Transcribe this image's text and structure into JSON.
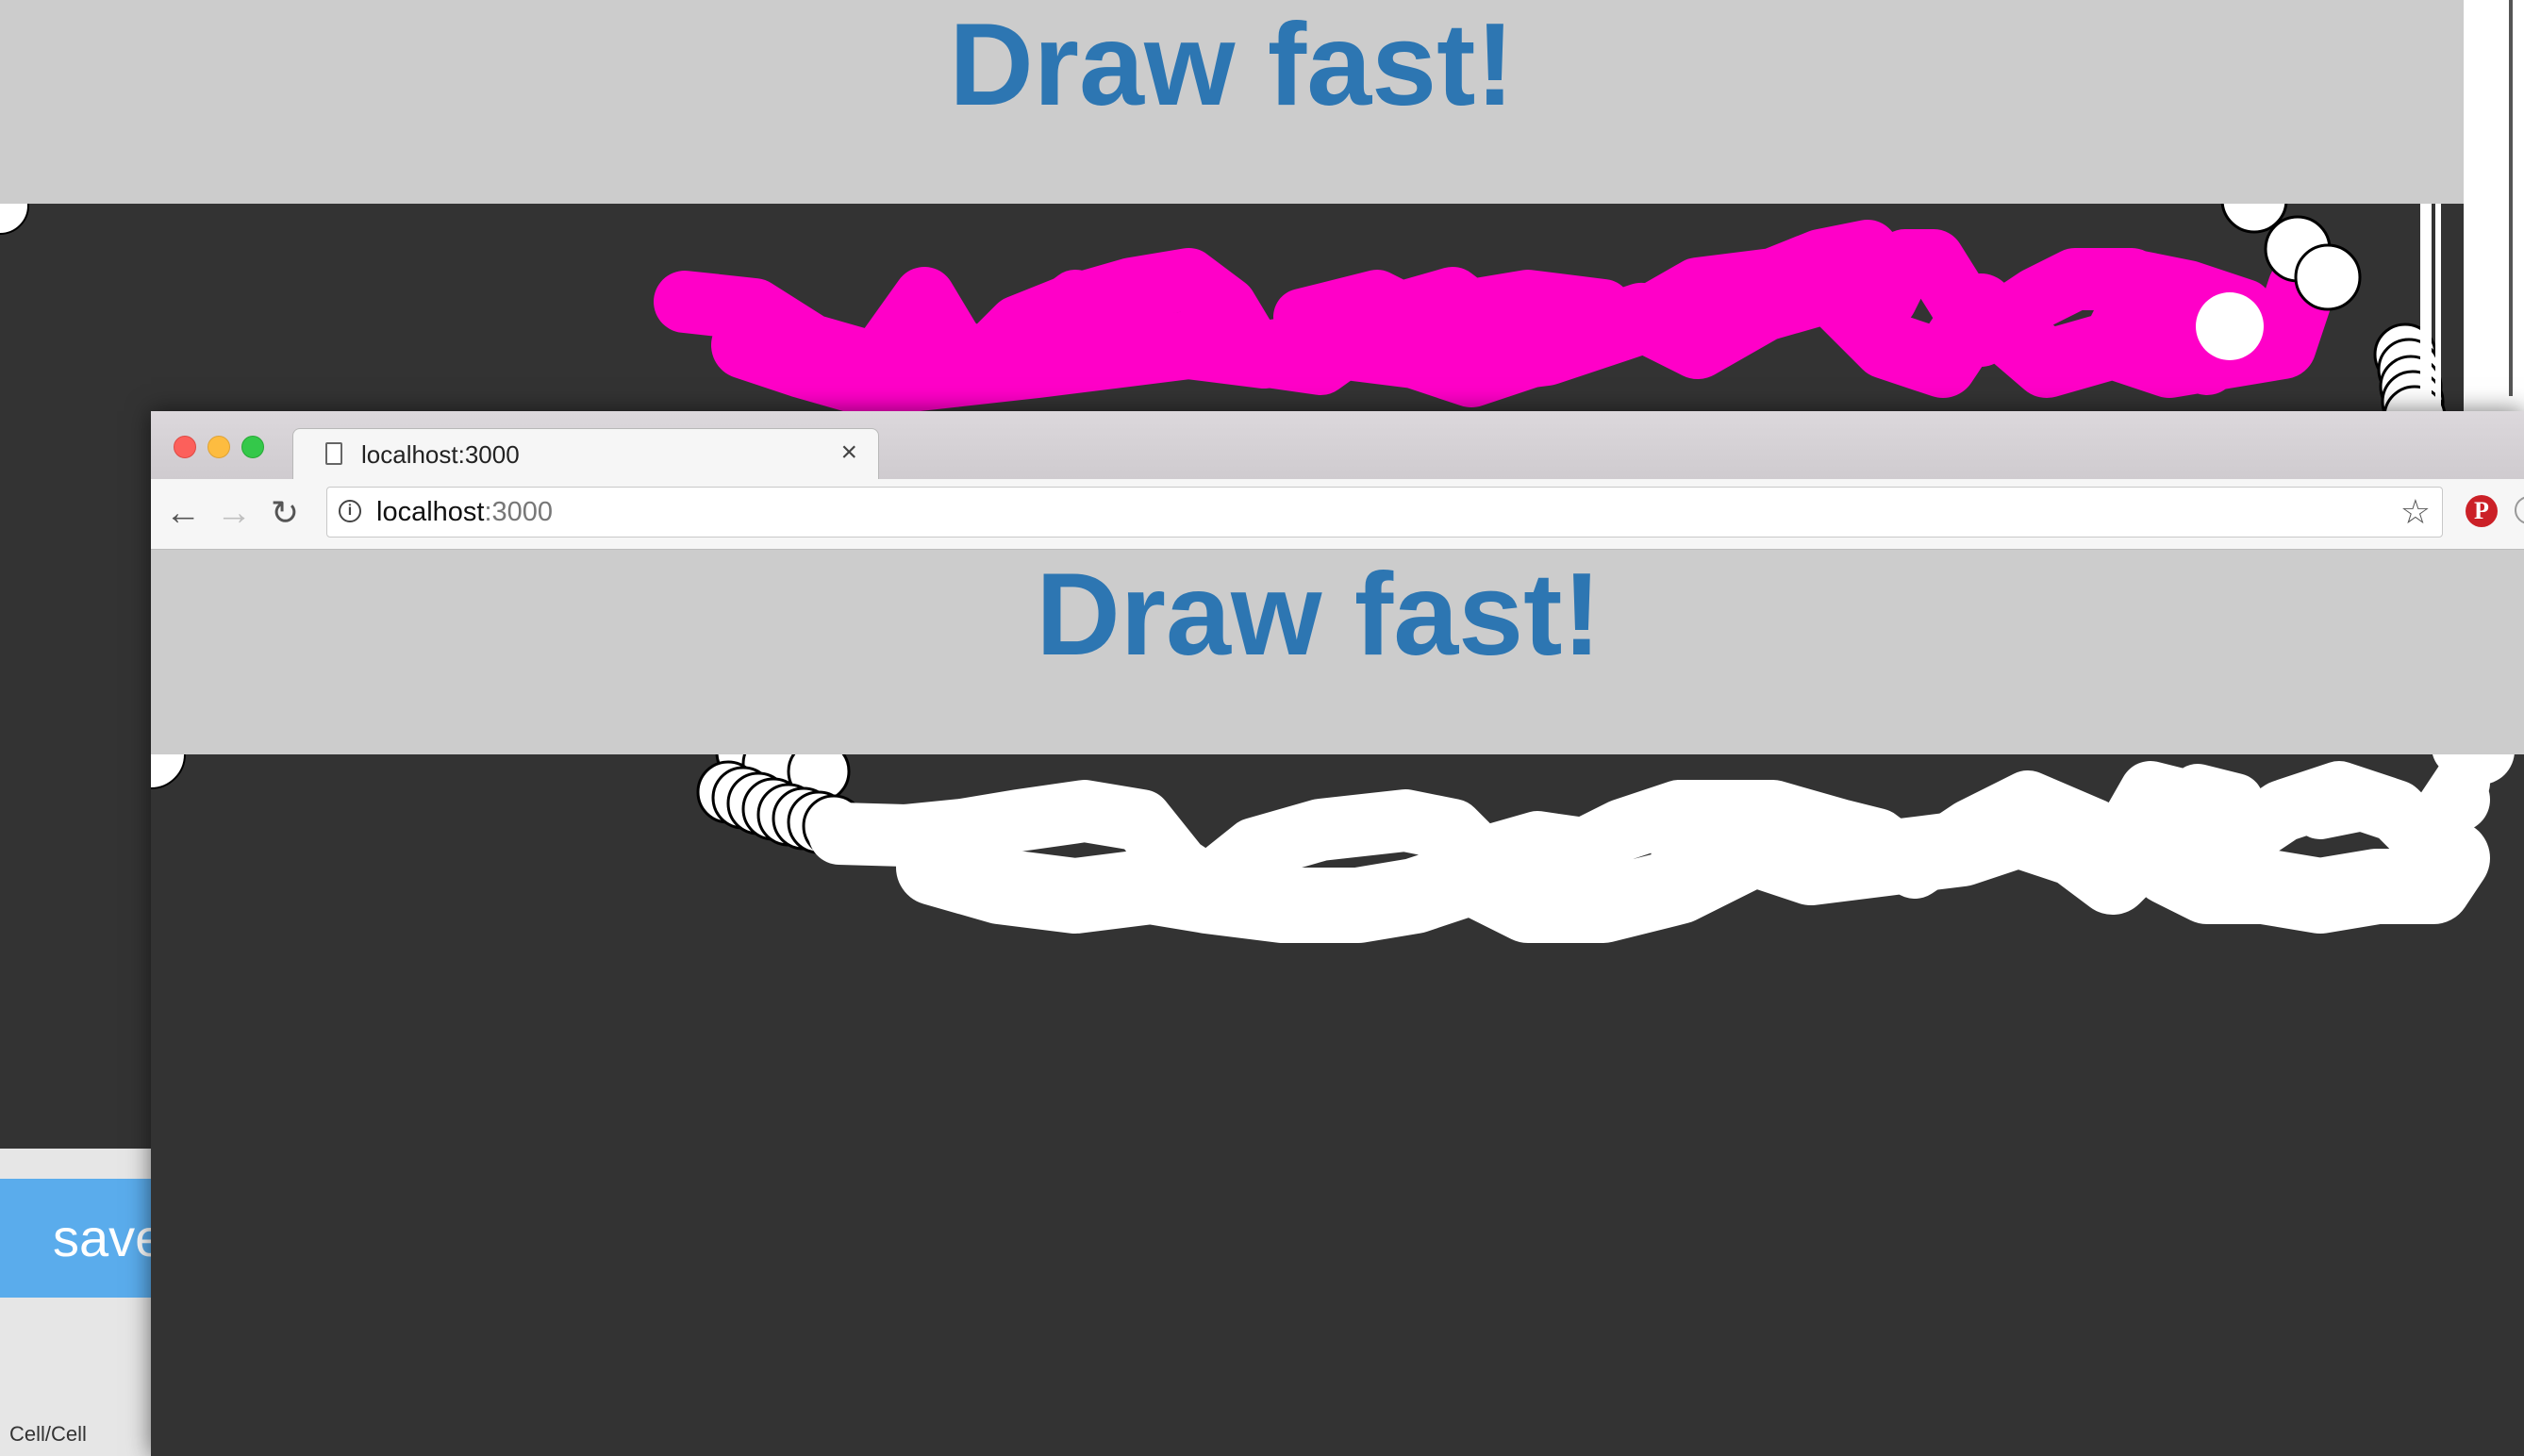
{
  "back_window": {
    "header_title": "Draw fast!",
    "save_button_label": "save",
    "status_text": "Cell/Cell",
    "stroke_color": "#ff00c8"
  },
  "browser": {
    "tab_title": "localhost:3000",
    "tab_close_glyph": "×",
    "url_host": "localhost",
    "url_port": ":3000",
    "icons": {
      "back": "back-arrow-icon",
      "forward": "forward-arrow-icon",
      "reload": "reload-icon",
      "info": "info-icon",
      "bookmark": "star-icon",
      "extension": "pinterest-icon"
    }
  },
  "front_window": {
    "header_title": "Draw fast!",
    "stroke_color": "#ffffff"
  },
  "colors": {
    "header_bg": "#cccccc",
    "title_text": "#2d76b2",
    "canvas_bg": "#333333"
  }
}
